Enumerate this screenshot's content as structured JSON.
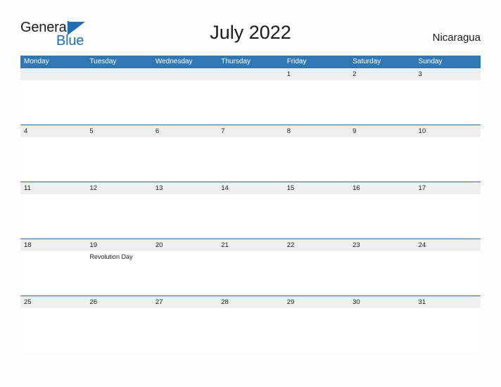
{
  "brand": {
    "word_one": "General",
    "word_two": "Blue",
    "triangle_icon": "triangle-icon",
    "color_primary": "#1f6fb5",
    "color_text": "#1a1a1a"
  },
  "header": {
    "title": "July 2022",
    "country": "Nicaragua"
  },
  "theme": {
    "header_blue": "#2f77b5",
    "row_border_blue": "#2b6ca3",
    "daynum_band": "#efefef",
    "page_bg": "#fdfdfd"
  },
  "calendar": {
    "weekday_headers": [
      "Monday",
      "Tuesday",
      "Wednesday",
      "Thursday",
      "Friday",
      "Saturday",
      "Sunday"
    ],
    "weeks": [
      [
        {
          "day": "",
          "event": ""
        },
        {
          "day": "",
          "event": ""
        },
        {
          "day": "",
          "event": ""
        },
        {
          "day": "",
          "event": ""
        },
        {
          "day": "1",
          "event": ""
        },
        {
          "day": "2",
          "event": ""
        },
        {
          "day": "3",
          "event": ""
        }
      ],
      [
        {
          "day": "4",
          "event": ""
        },
        {
          "day": "5",
          "event": ""
        },
        {
          "day": "6",
          "event": ""
        },
        {
          "day": "7",
          "event": ""
        },
        {
          "day": "8",
          "event": ""
        },
        {
          "day": "9",
          "event": ""
        },
        {
          "day": "10",
          "event": ""
        }
      ],
      [
        {
          "day": "11",
          "event": ""
        },
        {
          "day": "12",
          "event": ""
        },
        {
          "day": "13",
          "event": ""
        },
        {
          "day": "14",
          "event": ""
        },
        {
          "day": "15",
          "event": ""
        },
        {
          "day": "16",
          "event": ""
        },
        {
          "day": "17",
          "event": ""
        }
      ],
      [
        {
          "day": "18",
          "event": ""
        },
        {
          "day": "19",
          "event": "Revolution Day"
        },
        {
          "day": "20",
          "event": ""
        },
        {
          "day": "21",
          "event": ""
        },
        {
          "day": "22",
          "event": ""
        },
        {
          "day": "23",
          "event": ""
        },
        {
          "day": "24",
          "event": ""
        }
      ],
      [
        {
          "day": "25",
          "event": ""
        },
        {
          "day": "26",
          "event": ""
        },
        {
          "day": "27",
          "event": ""
        },
        {
          "day": "28",
          "event": ""
        },
        {
          "day": "29",
          "event": ""
        },
        {
          "day": "30",
          "event": ""
        },
        {
          "day": "31",
          "event": ""
        }
      ]
    ]
  }
}
